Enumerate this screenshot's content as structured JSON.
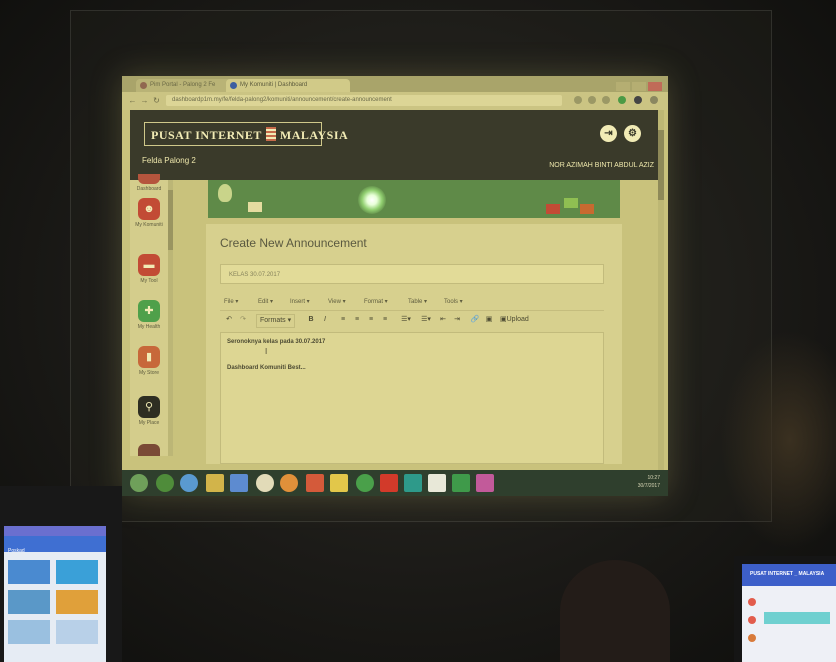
{
  "browser": {
    "tabs": [
      {
        "label": "Pim Portal - Palong 2 Fe"
      },
      {
        "label": "My Komuniti | Dashboard"
      }
    ],
    "url": "dashboardp1m.my/fe/felda-palong2/komuniti/announcement/create-announcement",
    "back_icon": "arrow-left-icon",
    "forward_icon": "arrow-right-icon",
    "reload_icon": "reload-icon"
  },
  "site": {
    "logo_left": "PUSAT INTERNET",
    "logo_right": "MALAYSIA",
    "location": "Felda Palong 2",
    "username": "NOR AZIMAH BINTI ABDUL AZIZ",
    "header_icons": [
      "logout-icon",
      "settings-icon"
    ]
  },
  "sidebar": {
    "items": [
      {
        "label": "Dashboard",
        "color": "#b5553d",
        "icon": "dashboard-icon"
      },
      {
        "label": "My Komuniti",
        "color": "#c24b35",
        "icon": "community-icon"
      },
      {
        "label": "My Tool",
        "color": "#c24b35",
        "icon": "tool-icon"
      },
      {
        "label": "My Health",
        "color": "#4fa04a",
        "icon": "health-icon"
      },
      {
        "label": "My Store",
        "color": "#c7683a",
        "icon": "store-icon"
      },
      {
        "label": "My Place",
        "color": "#2e2e22",
        "icon": "location-icon"
      }
    ]
  },
  "form": {
    "title": "Create New Announcement",
    "subject_value": "KELAS 30.07.2017",
    "menus": [
      "File",
      "Edit",
      "Insert",
      "View",
      "Format",
      "Table",
      "Tools"
    ],
    "toolbar": {
      "undo": "↶",
      "redo": "↷",
      "formats": "Formats",
      "bold": "B",
      "italic": "I",
      "upload": "Upload"
    },
    "content": {
      "line1": "Seronoknya kelas pada 30.07.2017",
      "line2": "Dashboard Komuniti Best..."
    }
  },
  "taskbar": {
    "time": "10:27",
    "date": "30/7/2017"
  },
  "foreground": {
    "left_monitor_label": "Poskad",
    "right_monitor_title": "PUSAT INTERNET _ MALAYSIA"
  }
}
